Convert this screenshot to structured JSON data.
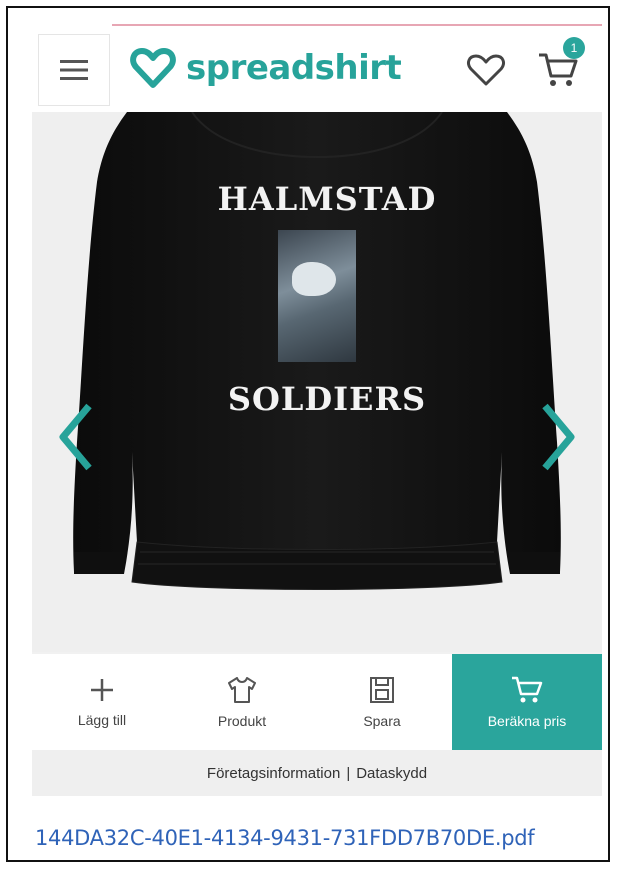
{
  "header": {
    "logo_text": "spreadshirt",
    "cart_count": "1",
    "brand_color": "#27a39a"
  },
  "product": {
    "print_top": "HALMSTAD",
    "print_bottom": "SOLDIERS",
    "garment_color": "#141414"
  },
  "toolbar": {
    "add_label": "Lägg till",
    "product_label": "Produkt",
    "save_label": "Spara",
    "price_label": "Beräkna pris"
  },
  "footer": {
    "company_info": "Företagsinformation",
    "separator": "|",
    "privacy": "Dataskydd"
  },
  "file": {
    "name": "144DA32C-40E1-4134-9431-731FDD7B70DE.pdf"
  },
  "icons": [
    "menu-icon",
    "heart-logo-icon",
    "heart-icon",
    "cart-icon",
    "chevron-left-icon",
    "chevron-right-icon",
    "plus-icon",
    "tshirt-icon",
    "save-icon",
    "cart-icon"
  ]
}
